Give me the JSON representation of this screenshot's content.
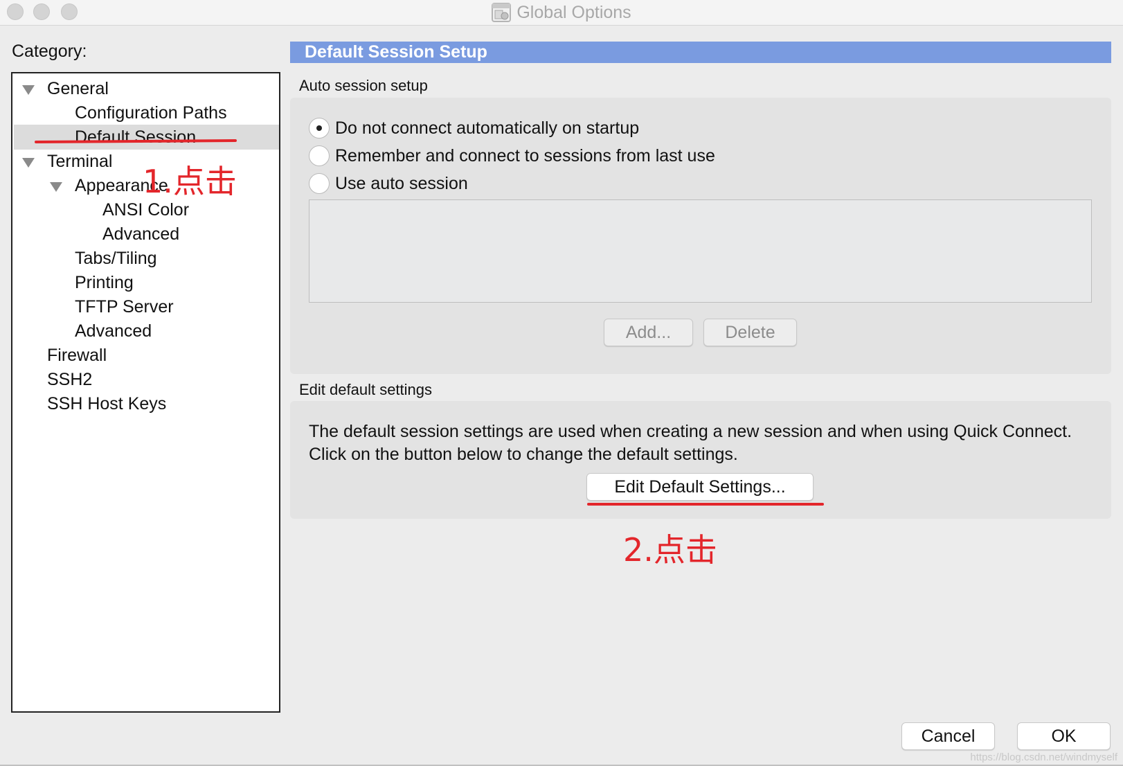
{
  "window": {
    "title": "Global Options"
  },
  "sidebar": {
    "category_label": "Category:",
    "items": [
      {
        "label": "General",
        "expanded": true
      },
      {
        "label": "Configuration Paths"
      },
      {
        "label": "Default Session",
        "selected": true
      },
      {
        "label": "Terminal",
        "expanded": true
      },
      {
        "label": "Appearance",
        "expanded": true
      },
      {
        "label": "ANSI Color"
      },
      {
        "label": "Advanced"
      },
      {
        "label": "Tabs/Tiling"
      },
      {
        "label": "Printing"
      },
      {
        "label": "TFTP Server"
      },
      {
        "label": "Advanced"
      },
      {
        "label": "Firewall"
      },
      {
        "label": "SSH2"
      },
      {
        "label": "SSH Host Keys"
      }
    ]
  },
  "main": {
    "header": "Default Session Setup",
    "auto_session": {
      "group_label": "Auto session setup",
      "options": [
        {
          "label": "Do not connect automatically on startup",
          "checked": true
        },
        {
          "label": "Remember and connect to sessions from last use",
          "checked": false
        },
        {
          "label": "Use auto session",
          "checked": false
        }
      ],
      "add_label": "Add...",
      "delete_label": "Delete"
    },
    "edit_defaults": {
      "group_label": "Edit default settings",
      "description": "The default session settings are used when creating a new session and when using Quick Connect.  Click on the button below to change the default settings.",
      "button_label": "Edit Default Settings..."
    }
  },
  "footer": {
    "cancel_label": "Cancel",
    "ok_label": "OK"
  },
  "annotations": {
    "step1": "1.点击",
    "step2": "2.点击",
    "color": "#e3262b"
  },
  "watermark": "https://blog.csdn.net/windmyself"
}
